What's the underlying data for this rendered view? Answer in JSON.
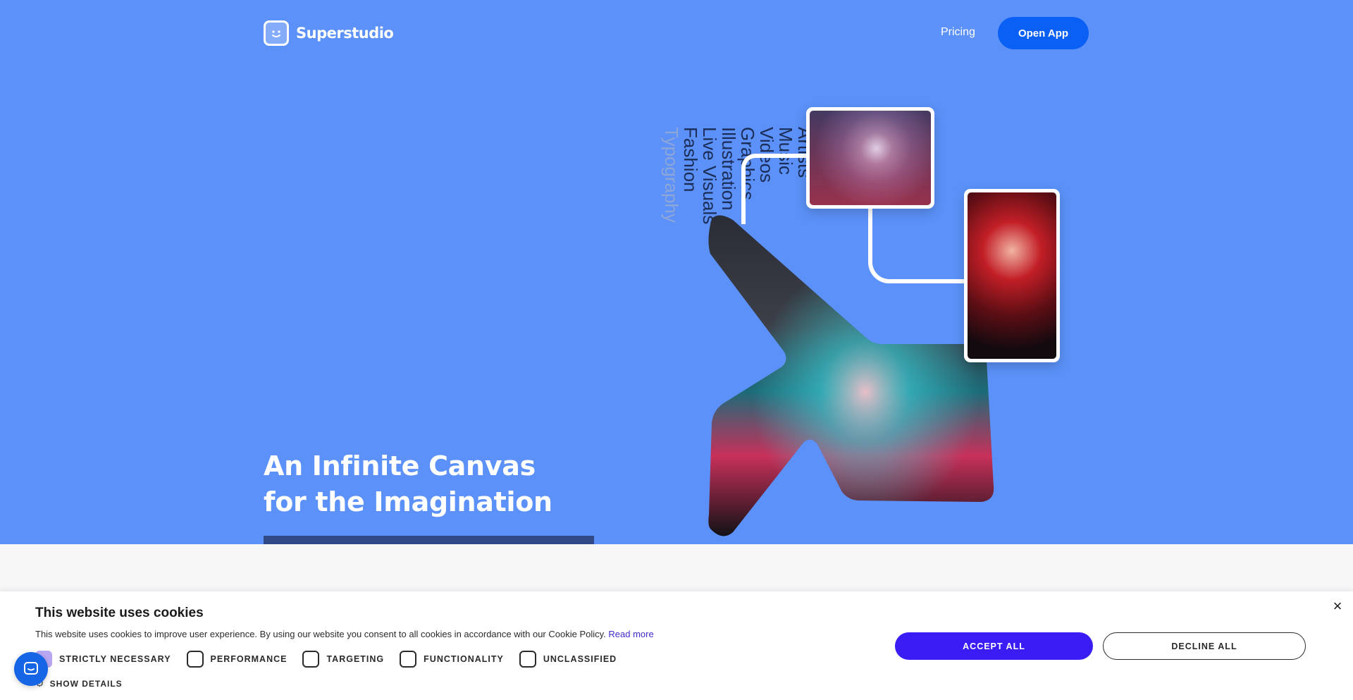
{
  "brand": {
    "name": "Superstudio",
    "logo_icon": "smiley-square-icon"
  },
  "nav": {
    "pricing_label": "Pricing",
    "open_app_label": "Open App"
  },
  "hero": {
    "headline_line1": "An Infinite Canvas",
    "headline_line2": "for the Imagination",
    "vertical_words": [
      "Artists",
      "Music",
      "Videos",
      "Graphics",
      "Illustration",
      "Live Visuals",
      "Fashion",
      "Typography"
    ],
    "colors": {
      "background": "#5b91f8",
      "accent_button": "#0a60f5"
    }
  },
  "cookie_banner": {
    "title": "This website uses cookies",
    "description": "This website uses cookies to improve user experience. By using our website you consent to all cookies in accordance with our Cookie Policy.",
    "read_more_label": "Read more",
    "options": [
      {
        "label": "STRICTLY NECESSARY",
        "checked": true
      },
      {
        "label": "PERFORMANCE",
        "checked": false
      },
      {
        "label": "TARGETING",
        "checked": false
      },
      {
        "label": "FUNCTIONALITY",
        "checked": false
      },
      {
        "label": "UNCLASSIFIED",
        "checked": false
      }
    ],
    "show_details_label": "SHOW DETAILS",
    "accept_label": "ACCEPT ALL",
    "decline_label": "DECLINE ALL",
    "close_icon": "close-icon",
    "colors": {
      "accept": "#3a1df5",
      "checked_box": "#b9a7f2",
      "link": "#3d2ccc"
    }
  },
  "chat": {
    "icon": "chat-bubble-icon"
  }
}
